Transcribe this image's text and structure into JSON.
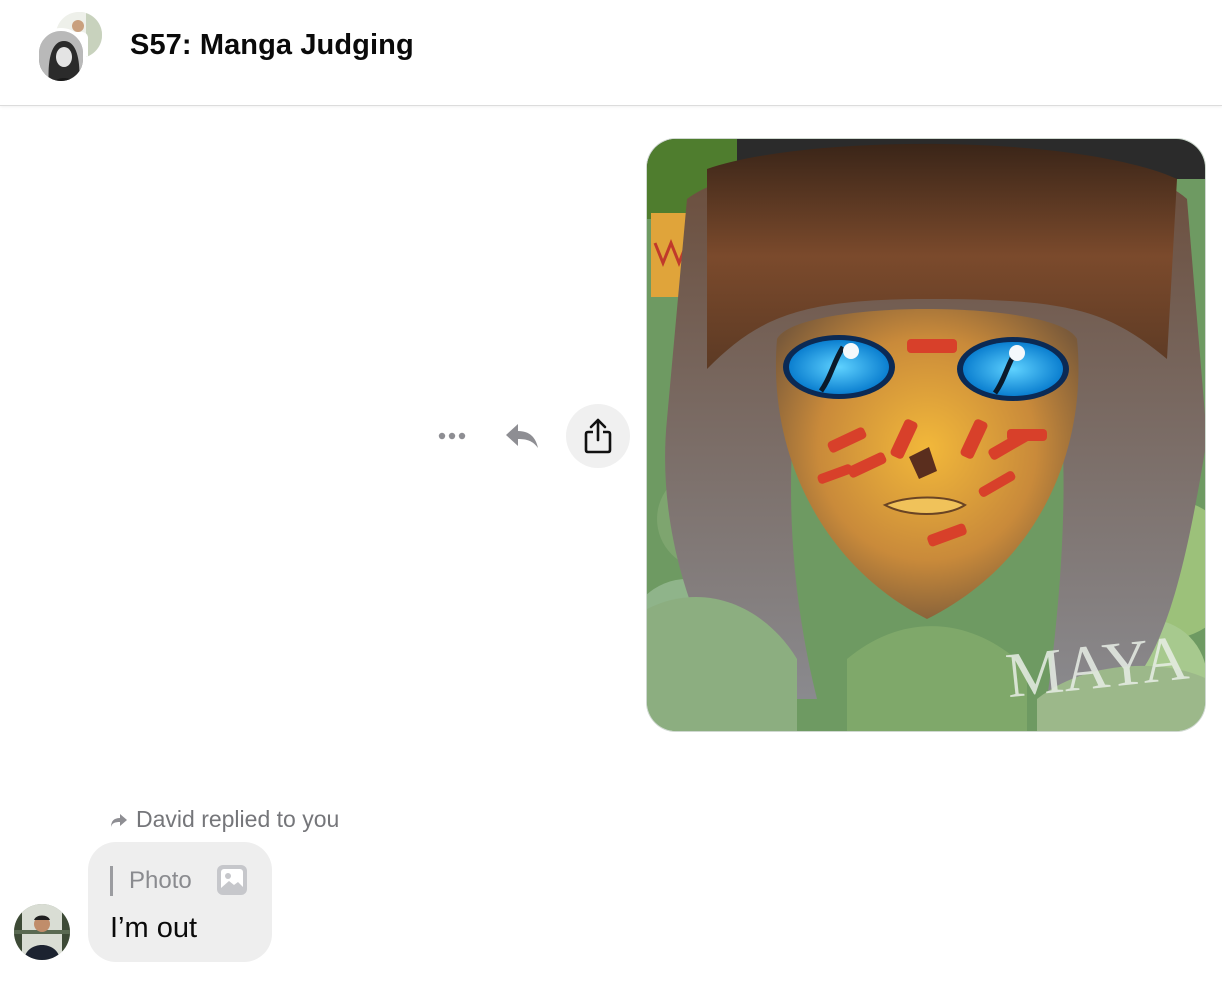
{
  "header": {
    "title": "S57: Manga Judging"
  },
  "photo_message": {
    "signature_text": "MAYA"
  },
  "actions": {
    "more_icon": "more-horizontal-icon",
    "reply_icon": "reply-icon",
    "share_icon": "share-icon"
  },
  "reply": {
    "note": "David replied to you",
    "quote_label": "Photo",
    "quote_icon": "image-icon",
    "text": "I’m out"
  },
  "colors": {
    "bubble": "#eeeeee",
    "secondary_text": "#75767a",
    "eye_blue": "#1fa8f0"
  }
}
